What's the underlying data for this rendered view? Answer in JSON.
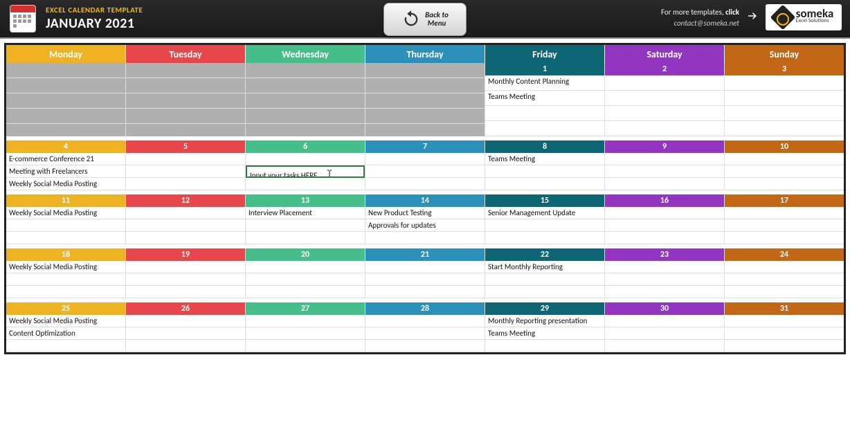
{
  "header": {
    "small_title": "EXCEL CALENDAR TEMPLATE",
    "big_title": "JANUARY 2021",
    "back_button": "Back to\nMenu",
    "more_templates_prefix": "For more templates, ",
    "more_templates_bold": "click",
    "arrow_icon": "arrow-right-icon",
    "contact": "contact@someka.net",
    "logo_name": "someka",
    "logo_sub": "Excel Solutions"
  },
  "calendar": {
    "day_headers": [
      "Monday",
      "Tuesday",
      "Wednesday",
      "Thursday",
      "Friday",
      "Saturday",
      "Sunday"
    ],
    "day_colors": [
      "col-mon",
      "col-tue",
      "col-wed",
      "col-thu",
      "col-fri",
      "col-sat",
      "col-sun"
    ],
    "rows_per_day_first_week": 4,
    "rows_per_day_other": 3,
    "editing_cell": {
      "week": 1,
      "day": 2,
      "row": 1,
      "text": "Input your tasks HERE ..."
    },
    "weeks": [
      [
        {
          "empty": true
        },
        {
          "empty": true
        },
        {
          "empty": true
        },
        {
          "empty": true
        },
        {
          "num": 1,
          "tasks": [
            "Monthly Content Planning",
            "Teams Meeting"
          ]
        },
        {
          "num": 2,
          "tasks": []
        },
        {
          "num": 3,
          "tasks": []
        }
      ],
      [
        {
          "num": 4,
          "tasks": [
            "E-commerce Conference 21",
            "Meeting with Freelancers",
            "Weekly Social Media Posting"
          ]
        },
        {
          "num": 5,
          "tasks": []
        },
        {
          "num": 6,
          "tasks": []
        },
        {
          "num": 7,
          "tasks": []
        },
        {
          "num": 8,
          "tasks": [
            "Teams Meeting"
          ]
        },
        {
          "num": 9,
          "tasks": []
        },
        {
          "num": 10,
          "tasks": []
        }
      ],
      [
        {
          "num": 11,
          "tasks": [
            "Weekly Social Media Posting"
          ]
        },
        {
          "num": 12,
          "tasks": []
        },
        {
          "num": 13,
          "tasks": [
            "Interview Placement"
          ]
        },
        {
          "num": 14,
          "tasks": [
            "New Product Testing",
            "Approvals for updates"
          ]
        },
        {
          "num": 15,
          "tasks": [
            "Senior Management Update"
          ]
        },
        {
          "num": 16,
          "tasks": []
        },
        {
          "num": 17,
          "tasks": []
        }
      ],
      [
        {
          "num": 18,
          "tasks": [
            "Weekly Social Media Posting"
          ]
        },
        {
          "num": 19,
          "tasks": []
        },
        {
          "num": 20,
          "tasks": []
        },
        {
          "num": 21,
          "tasks": []
        },
        {
          "num": 22,
          "tasks": [
            "Start Monthly Reporting"
          ]
        },
        {
          "num": 23,
          "tasks": []
        },
        {
          "num": 24,
          "tasks": []
        }
      ],
      [
        {
          "num": 25,
          "tasks": [
            "Weekly Social Media Posting",
            "Content Optimization"
          ]
        },
        {
          "num": 26,
          "tasks": []
        },
        {
          "num": 27,
          "tasks": []
        },
        {
          "num": 28,
          "tasks": []
        },
        {
          "num": 29,
          "tasks": [
            "Monthly Reporting presentation",
            "Teams Meeting"
          ]
        },
        {
          "num": 30,
          "tasks": []
        },
        {
          "num": 31,
          "tasks": []
        }
      ]
    ]
  }
}
